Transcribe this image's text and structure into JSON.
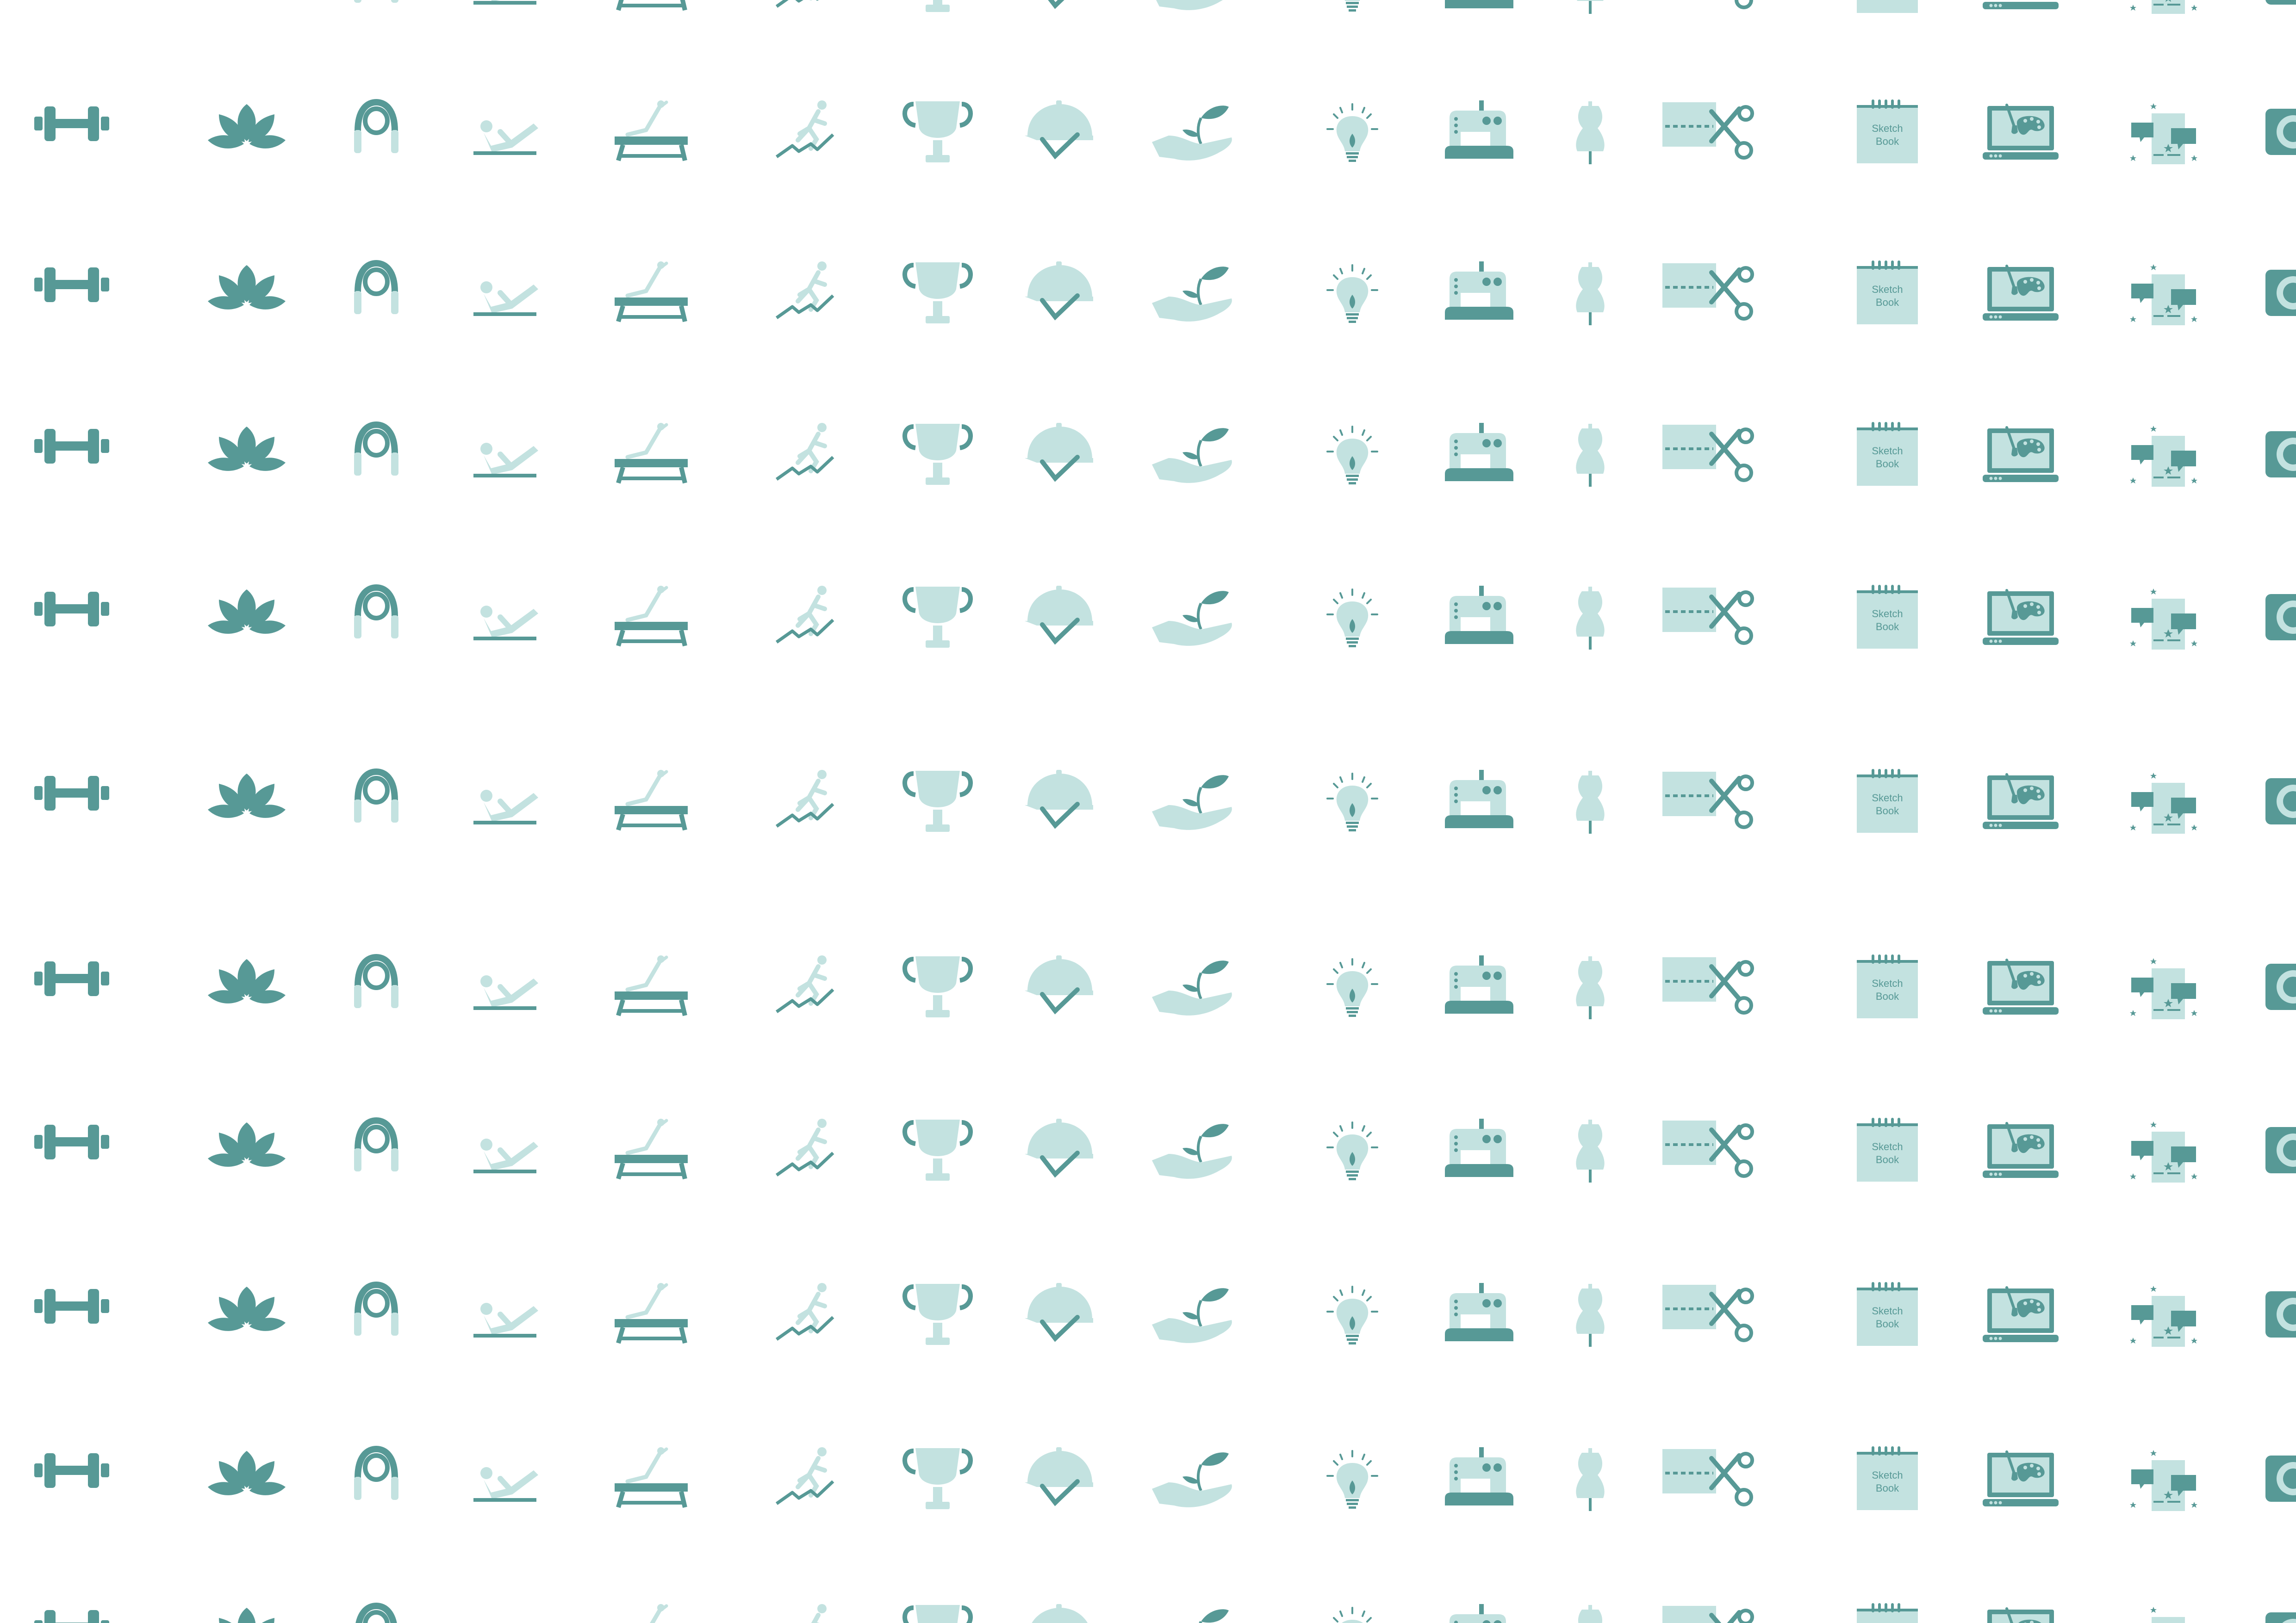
{
  "title": "",
  "colors": {
    "dark": "#579996",
    "light": "#c3e2e0",
    "background": "#ffffff"
  },
  "icons": [
    "dumbbell-icon",
    "lotus-icon",
    "jump-rope-icon",
    "pilates-icon",
    "balance-beam-icon",
    "runner-icon",
    "trophy-icon",
    "riding-helmet-icon",
    "hand-sprout-icon",
    "lightbulb-icon",
    "sewing-machine-icon",
    "dress-form-icon",
    "fabric-scissors-icon",
    "sketchbook-icon",
    "laptop-palette-icon",
    "chat-stars-icon",
    "camera-icon"
  ],
  "sketchbook_label_line1": "Sketch",
  "sketchbook_label_line2": "Book"
}
